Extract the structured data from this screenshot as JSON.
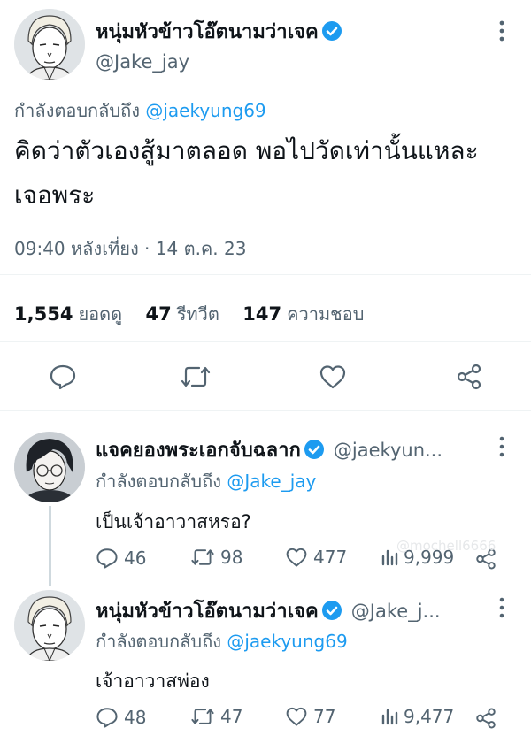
{
  "main_tweet": {
    "display_name": "หนุ่มหัวข้าวโอ๊ตนามว่าเจค",
    "handle": "@Jake_jay",
    "reply_prefix": "กำลังตอบกลับถึง",
    "reply_mention": "@jaekyung69",
    "text_line1": "คิดว่าตัวเองสู้มาตลอด พอไปวัดเท่านั้นแหละ",
    "text_line2": "เจอพระ",
    "timestamp": "09:40 หลังเที่ยง · 14 ต.ค. 23",
    "views_count": "1,554",
    "views_label": "ยอดดู",
    "retweets_count": "47",
    "retweets_label": "รีทวีต",
    "likes_count": "147",
    "likes_label": "ความชอบ"
  },
  "reply_1": {
    "display_name": "แจคยองพระเอกจับฉลาก",
    "handle": "@jaekyun...",
    "reply_prefix": "กำลังตอบกลับถึง",
    "reply_mention": "@Jake_jay",
    "text": "เป็นเจ้าอาวาสหรอ?",
    "replies": "46",
    "retweets": "98",
    "likes": "477",
    "views": "9,999"
  },
  "reply_2": {
    "display_name": "หนุ่มหัวข้าวโอ๊ตนามว่าเจค",
    "handle": "@Jake_j...",
    "reply_prefix": "กำลังตอบกลับถึง",
    "reply_mention": "@jaekyung69",
    "text": "เจ้าอาวาสพ่อง",
    "replies": "48",
    "retweets": "47",
    "likes": "77",
    "views": "9,477"
  },
  "watermark": "@mochell6666",
  "colors": {
    "accent": "#1d9bf0",
    "secondary_text": "#536471",
    "primary_text": "#0f1419",
    "divider": "#eff3f4"
  },
  "icons": [
    "more-icon",
    "verified-badge-icon",
    "reply-icon",
    "retweet-icon",
    "like-icon",
    "share-icon",
    "views-icon"
  ]
}
